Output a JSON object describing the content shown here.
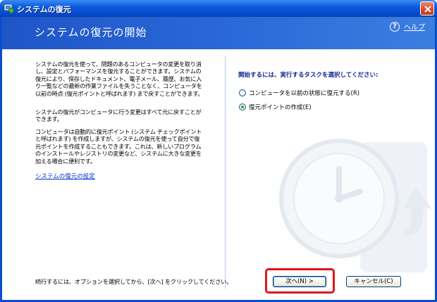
{
  "window": {
    "title": "システムの復元"
  },
  "header": {
    "title": "システムの復元の開始",
    "help_label": "ヘルプ",
    "help_icon": "?"
  },
  "left": {
    "paragraph1": "システムの復元を使って、問題のあるコンピュータの変更を取り消し、設定とパフォーマンスを復元することができます。システムの復元により、保存したドキュメント、電子メール、履歴、お気に入り一覧などの最新の作業ファイルを失うことなく、コンピュータを以前の時点 (復元ポイントと呼ばれます) まで戻すことができます。",
    "paragraph2": "システムの復元がコンピュータに行う変更はすべて元に戻すことができます。",
    "paragraph3": "コンピュータは自動的に復元ポイント (システム チェックポイントと呼ばれます) を作成しますが、システムの復元を使って自分で復元ポイントを作成することもできます。これは、新しいプログラムのインストールやレジストリの変更など、システムに大きな変更を加える場合に便利です。",
    "settings_link": "システムの復元の設定"
  },
  "right": {
    "prompt": "開始するには、実行するタスクを選択してください:",
    "options": [
      {
        "label": "コンピュータを以前の状態に復元する(R)",
        "selected": false
      },
      {
        "label": "復元ポイントの作成(E)",
        "selected": true
      }
    ]
  },
  "footer": {
    "instruction": "続行するには、オプションを選択してから、[次へ] をクリックしてください。",
    "next_label": "次へ(N) >",
    "cancel_label": "キャンセル(C)"
  },
  "colors": {
    "titlebar": "#0b5ae0",
    "header": "#2a67d8",
    "highlight": "#e0141a"
  }
}
